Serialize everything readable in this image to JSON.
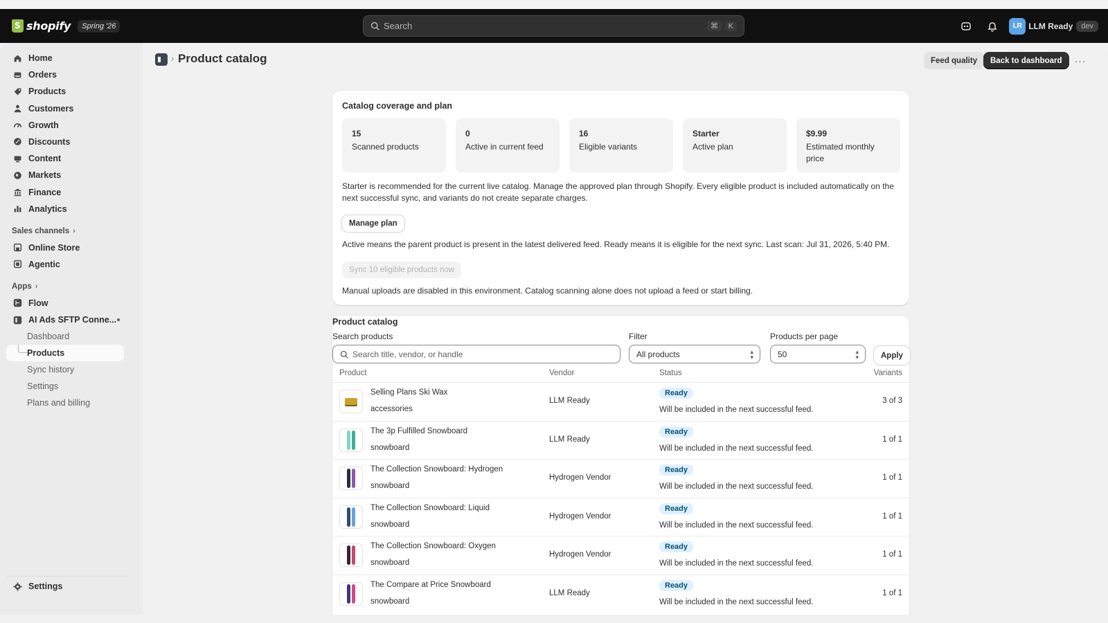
{
  "topbar": {
    "logo_text": "shopify",
    "edition": "Spring '26",
    "search_placeholder": "Search",
    "shortcut_cmd": "⌘",
    "shortcut_key": "K",
    "avatar_initials": "LR",
    "store_name": "LLM Ready",
    "env_badge": "dev"
  },
  "sidebar": {
    "items": [
      {
        "label": "Home",
        "icon": "home-icon"
      },
      {
        "label": "Orders",
        "icon": "orders-icon"
      },
      {
        "label": "Products",
        "icon": "tag-icon"
      },
      {
        "label": "Customers",
        "icon": "person-icon"
      },
      {
        "label": "Growth",
        "icon": "gauge-icon"
      },
      {
        "label": "Discounts",
        "icon": "discount-icon"
      },
      {
        "label": "Content",
        "icon": "content-icon"
      },
      {
        "label": "Markets",
        "icon": "globe-icon"
      },
      {
        "label": "Finance",
        "icon": "bank-icon"
      },
      {
        "label": "Analytics",
        "icon": "bar-chart-icon"
      }
    ],
    "sales_channels_label": "Sales channels",
    "sales_channels": [
      {
        "label": "Online Store",
        "icon": "store-icon"
      },
      {
        "label": "Agentic",
        "icon": "agent-icon"
      }
    ],
    "apps_label": "Apps",
    "apps": [
      {
        "label": "Flow",
        "icon": "flow-icon"
      },
      {
        "label": "AI Ads SFTP Conne...",
        "icon": "app-icon"
      }
    ],
    "app_subitems": [
      "Dashboard",
      "Products",
      "Sync history",
      "Settings",
      "Plans and billing"
    ],
    "active_subitem": "Products",
    "settings_label": "Settings"
  },
  "header": {
    "title": "Product catalog",
    "feed_quality": "Feed quality",
    "back_to_dashboard": "Back to dashboard"
  },
  "coverage": {
    "title": "Catalog coverage and plan",
    "stats": [
      {
        "value": "15",
        "label": "Scanned products"
      },
      {
        "value": "0",
        "label": "Active in current feed"
      },
      {
        "value": "16",
        "label": "Eligible variants"
      },
      {
        "value": "Starter",
        "label": "Active plan"
      },
      {
        "value": "$9.99",
        "label": "Estimated monthly price"
      }
    ],
    "recommendation": "Starter is recommended for the current live catalog. Manage the approved plan through Shopify. Every eligible product is included automatically on the next successful sync, and variants do not create separate charges.",
    "manage_plan": "Manage plan",
    "active_note": "Active means the parent product is present in the latest delivered feed. Ready means it is eligible for the next sync. Last scan: Jul 31, 2026, 5:40 PM.",
    "sync_button": "Sync 10 eligible products now",
    "manual_note": "Manual uploads are disabled in this environment. Catalog scanning alone does not upload a feed or start billing."
  },
  "catalog": {
    "title": "Product catalog",
    "search_label": "Search products",
    "search_placeholder": "Search title, vendor, or handle",
    "filter_label": "Filter",
    "filter_value": "All products",
    "per_page_label": "Products per page",
    "per_page_value": "50",
    "apply": "Apply",
    "columns": [
      "Product",
      "Vendor",
      "Status",
      "Variants"
    ],
    "rows": [
      {
        "title": "Selling Plans Ski Wax",
        "type": "accessories",
        "vendor": "LLM Ready",
        "status": "Ready",
        "note": "Will be included in the next successful feed.",
        "variants": "3 of 3",
        "colors": [
          "#c9a227",
          "#7a5a1e"
        ]
      },
      {
        "title": "The 3p Fulfilled Snowboard",
        "type": "snowboard",
        "vendor": "LLM Ready",
        "status": "Ready",
        "note": "Will be included in the next successful feed.",
        "variants": "1 of 1",
        "colors": [
          "#7fd6c2",
          "#3fae9a"
        ]
      },
      {
        "title": "The Collection Snowboard: Hydrogen",
        "type": "snowboard",
        "vendor": "Hydrogen Vendor",
        "status": "Ready",
        "note": "Will be included in the next successful feed.",
        "variants": "1 of 1",
        "colors": [
          "#2b2b3a",
          "#8e5aa8"
        ]
      },
      {
        "title": "The Collection Snowboard: Liquid",
        "type": "snowboard",
        "vendor": "Hydrogen Vendor",
        "status": "Ready",
        "note": "Will be included in the next successful feed.",
        "variants": "1 of 1",
        "colors": [
          "#2f4a7a",
          "#6ea0d8"
        ]
      },
      {
        "title": "The Collection Snowboard: Oxygen",
        "type": "snowboard",
        "vendor": "Hydrogen Vendor",
        "status": "Ready",
        "note": "Will be included in the next successful feed.",
        "variants": "1 of 1",
        "colors": [
          "#3a2233",
          "#c44a6a"
        ]
      },
      {
        "title": "The Compare at Price Snowboard",
        "type": "snowboard",
        "vendor": "LLM Ready",
        "status": "Ready",
        "note": "Will be included in the next successful feed.",
        "variants": "1 of 1",
        "colors": [
          "#3a3a7a",
          "#d04a8a"
        ]
      }
    ]
  }
}
